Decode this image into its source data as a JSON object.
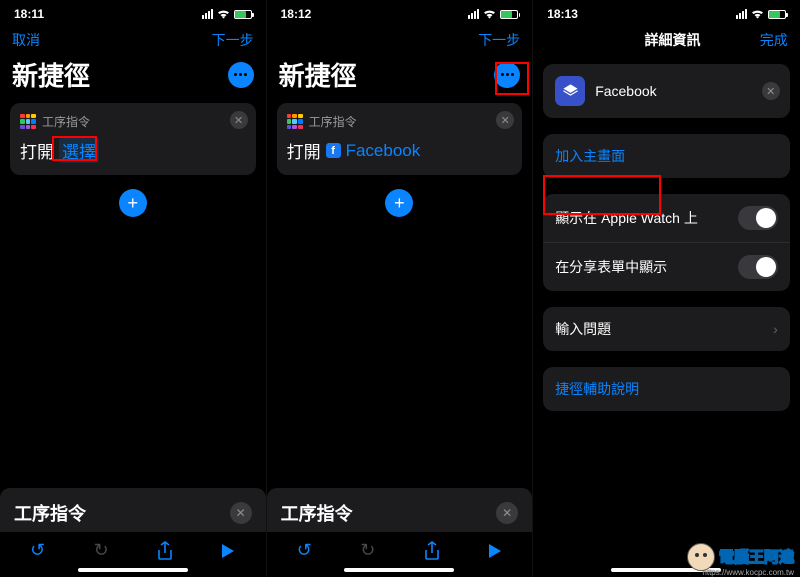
{
  "pane1": {
    "time": "18:11",
    "nav_cancel": "取消",
    "nav_next": "下一步",
    "title": "新捷徑",
    "card_label": "工序指令",
    "open_word": "打開",
    "token_select": "選擇",
    "search_title": "工序指令"
  },
  "pane2": {
    "time": "18:12",
    "nav_next": "下一步",
    "title": "新捷徑",
    "card_label": "工序指令",
    "open_word": "打開",
    "facebook": "Facebook",
    "search_title": "工序指令"
  },
  "pane3": {
    "time": "18:13",
    "nav_title": "詳細資訊",
    "nav_done": "完成",
    "tile_name": "Facebook",
    "row_add_home": "加入主畫面",
    "row_apple_watch": "顯示在 Apple Watch 上",
    "row_share_sheet": "在分享表單中顯示",
    "row_input_q": "輸入問題",
    "row_help": "捷徑輔助說明"
  },
  "watermark": {
    "text": "電腦王阿達",
    "url": "https://www.kocpc.com.tw"
  },
  "colors": {
    "accent": "#0a84ff",
    "bg_card": "#1c1c1e",
    "red": "#ff0000"
  }
}
